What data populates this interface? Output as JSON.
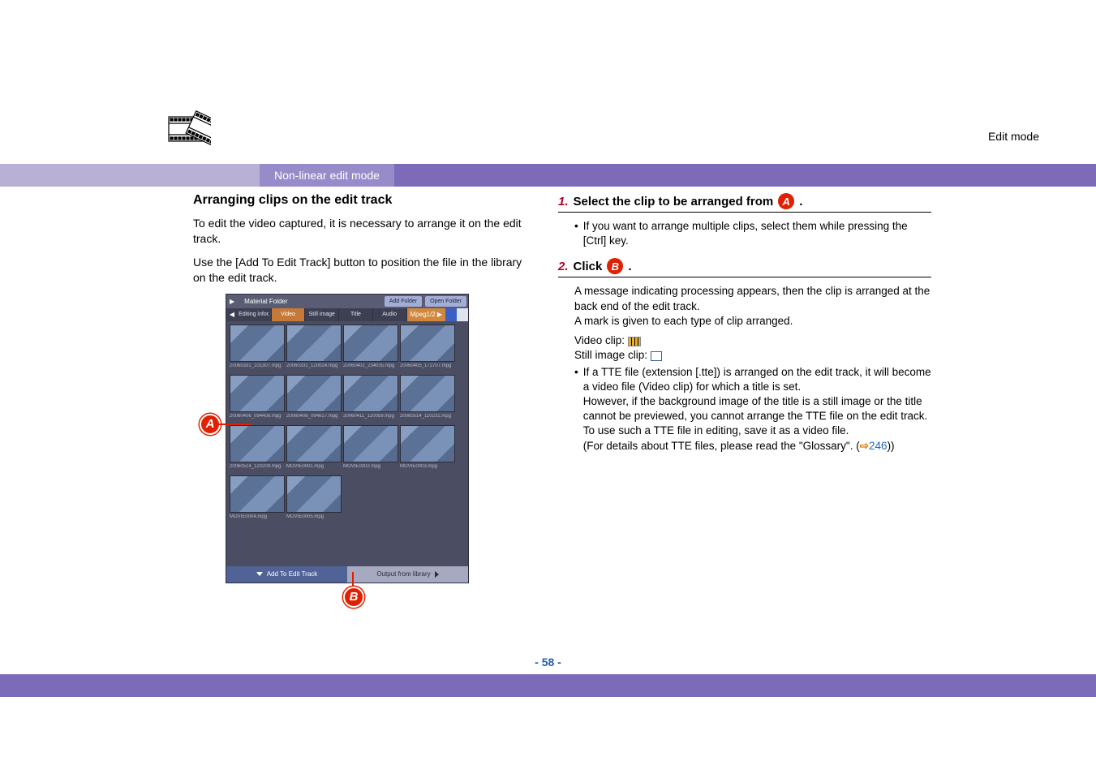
{
  "header": {
    "edit_mode_label": "Edit mode",
    "subheading": "Non-linear edit mode"
  },
  "left": {
    "section_title": "Arranging clips on the edit track",
    "intro_line1": "To edit the video captured, it is necessary to arrange it on the edit track.",
    "intro_line2": "Use the [Add To Edit Track] button to position the file in the library on the edit track."
  },
  "shot": {
    "material_folder": "Material Folder",
    "add_folder": "Add Folder",
    "open_folder": "Open Folder",
    "tab_editing": "Editing infor.",
    "tab_video": "Video",
    "tab_still": "Still image",
    "tab_title": "Title",
    "tab_audio": "Audio",
    "format": "Mpeg1/2",
    "row1_caps": [
      "20060331_101307.mpg",
      "20060331_120024.mpg",
      "20060402_234035.mpg",
      "20060405_172707.mpg"
    ],
    "row2_caps": [
      "20060406_094408.mpg",
      "20060406_094617.mpg",
      "20060411_120059.mpg",
      "20060514_110231.mpg"
    ],
    "row3_caps": [
      "20060514_120209.mpg",
      "MOVIE0001.mpg",
      "MOVIE0002.mpg",
      "MOVIE0003.mpg"
    ],
    "row4_caps": [
      "MOVIE0004.mpg",
      "MOVIE0005.mpg"
    ],
    "btn_add": "Add To Edit Track",
    "btn_output": "Output from library"
  },
  "markers": {
    "A": "A",
    "B": "B"
  },
  "right": {
    "step1_num": "1.",
    "step1_text": "Select the clip to be arranged from ",
    "step1_period": ".",
    "step1_note": "If you want to arrange multiple clips, select them while pressing the [Ctrl] key.",
    "step2_num": "2.",
    "step2_text": "Click ",
    "step2_period": ".",
    "step2_body1": "A message indicating processing appears, then the clip is arranged at the back end of the edit track.",
    "step2_body2": "A mark is given to each type of clip arranged.",
    "video_clip_label": "Video clip:",
    "still_clip_label": "Still image clip:",
    "tte_bullet_line1": "If a TTE file (extension [.tte]) is arranged on the edit track, it will become a video file (Video clip) for which a title is set.",
    "tte_para1": "However, if the background image of the title is a still image or the title cannot be previewed, you cannot arrange the TTE file on the edit track. To use such a TTE file in editing, save it as a video file.",
    "tte_para2_a": "(For details about TTE files, please read the \"Glossary\". (",
    "tte_link_num": "246",
    "tte_para2_b": "))"
  },
  "footer": {
    "page_number": "- 58 -"
  }
}
